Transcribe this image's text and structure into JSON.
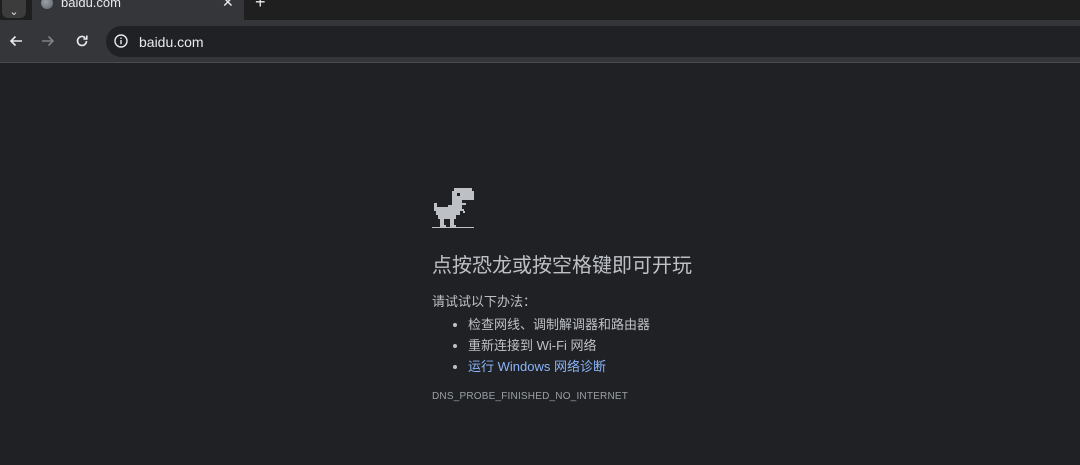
{
  "tab": {
    "title": "baidu.com",
    "close_glyph": "✕",
    "new_tab_glyph": "+",
    "menu_glyph": "⌄"
  },
  "omnibox": {
    "url": "baidu.com"
  },
  "error": {
    "heading": "点按恐龙或按空格键即可开玩",
    "suggestions_intro": "请试试以下办法：",
    "suggestions": [
      "检查网线、调制解调器和路由器",
      "重新连接到 Wi-Fi 网络",
      "运行 Windows 网络诊断"
    ],
    "error_code": "DNS_PROBE_FINISHED_NO_INTERNET"
  },
  "colors": {
    "page_bg": "#202124",
    "text": "#bdc1c6",
    "link": "#8ab4f8"
  },
  "icons": {
    "back": "arrow-left-icon",
    "forward": "arrow-right-icon",
    "reload": "reload-icon",
    "site_info": "info-icon",
    "dino": "dinosaur-icon"
  }
}
